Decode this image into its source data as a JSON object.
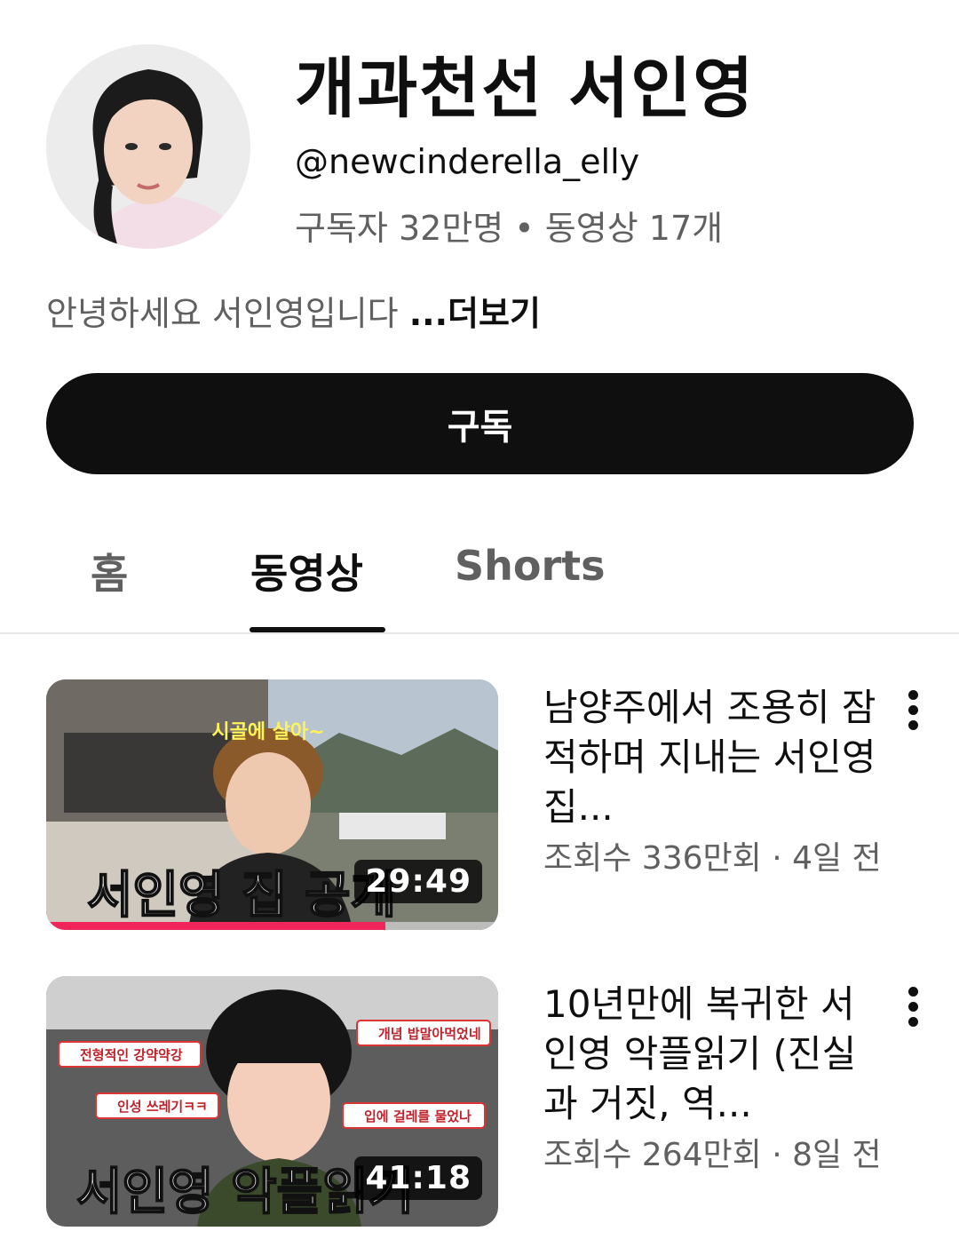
{
  "channel": {
    "name": "개과천선 서인영",
    "handle": "@newcinderella_elly",
    "stats": "구독자 32만명 • 동영상 17개",
    "description": "안녕하세요 서인영입니다 ",
    "more_label": "...더보기",
    "avatar_icon": "avatar-photo"
  },
  "subscribe_label": "구독",
  "tabs": [
    {
      "label": "홈",
      "active": false
    },
    {
      "label": "동영상",
      "active": true
    },
    {
      "label": "Shorts",
      "active": false
    }
  ],
  "videos": [
    {
      "title": "남양주에서 조용히 잠적하며 지내는 서인영 집...",
      "meta": "조회수 336만회 · 4일 전",
      "duration": "29:49",
      "thumb_caption": "서인영 집 공개",
      "thumb_bubble": "시골에 살아~",
      "watched_fraction": 0.75
    },
    {
      "title": "10년만에 복귀한 서인영 악플읽기 (진실과 거짓, 역...",
      "meta": "조회수 264만회 · 8일 전",
      "duration": "41:18",
      "thumb_caption": "서인영 악플읽기",
      "thumb_comments": [
        "전형적인 강약약강",
        "개념 밥말아먹었네",
        "인성 쓰레기ㅋㅋ",
        "입에 걸레를 물었나"
      ]
    }
  ],
  "colors": {
    "accent_progress": "#f0255a",
    "text_primary": "#0f0f0f",
    "text_secondary": "#606060"
  }
}
